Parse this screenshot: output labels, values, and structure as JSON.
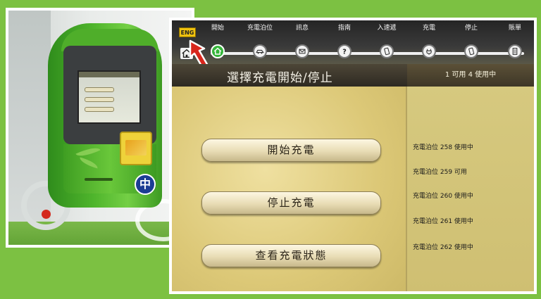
{
  "kiosk_photo": {
    "logo_text": "中"
  },
  "topbar": {
    "eng_label": "ENG",
    "steps": [
      {
        "label": "開始",
        "icon": "home-icon"
      },
      {
        "label": "充電泊位",
        "icon": "car-icon"
      },
      {
        "label": "訊息",
        "icon": "envelope-icon"
      },
      {
        "label": "指南",
        "icon": "question-icon"
      },
      {
        "label": "入速遞",
        "icon": "card-icon"
      },
      {
        "label": "充電",
        "icon": "plug-icon"
      },
      {
        "label": "停止",
        "icon": "card-icon"
      },
      {
        "label": "賬單",
        "icon": "receipt-icon"
      }
    ]
  },
  "title_bar": {
    "title": "選擇充電開始/停止",
    "usage": "1 可用 4 使用中"
  },
  "actions": {
    "start": "開始充電",
    "stop": "停止充電",
    "status": "查看充電狀態"
  },
  "bays": [
    "充電泊位 258 使用中",
    "充電泊位 259 可用",
    "充電泊位 260 使用中",
    "充電泊位 261 使用中",
    "充電泊位 262 使用中"
  ],
  "colors": {
    "background": "#7cc142",
    "active_step": "#35b53a",
    "eng_button": "#f0c20f",
    "pointer_arrow": "#d8261c"
  }
}
